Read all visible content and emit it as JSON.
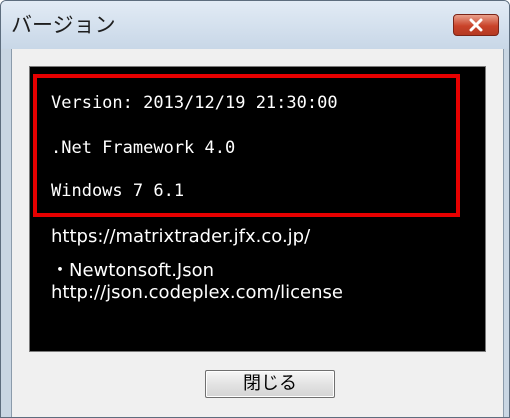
{
  "window": {
    "title": "バージョン",
    "close_icon": "close-icon"
  },
  "info": {
    "version_line": "Version: 2013/12/19 21:30:00",
    "framework_line": ".Net Framework 4.0",
    "os_line": "Windows 7 6.1",
    "url": "https://matrixtrader.jfx.co.jp/",
    "library_name": "・Newtonsoft.Json",
    "library_license_url": "http://json.codeplex.com/license"
  },
  "buttons": {
    "close_label": "閉じる"
  },
  "colors": {
    "highlight_border": "#e60000",
    "panel_background": "#000000",
    "panel_text": "#ffffff",
    "close_button_red": "#c9432a"
  }
}
